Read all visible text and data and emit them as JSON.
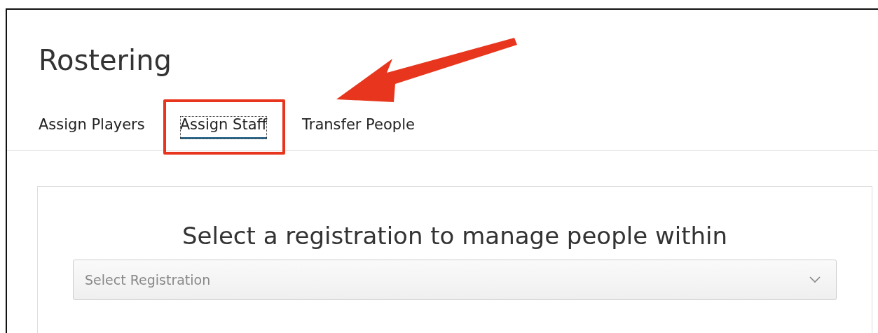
{
  "page": {
    "title": "Rostering"
  },
  "tabs": [
    {
      "label": "Assign Players",
      "selected": false,
      "highlighted": false
    },
    {
      "label": "Assign Staff",
      "selected": true,
      "highlighted": true
    },
    {
      "label": "Transfer People",
      "selected": false,
      "highlighted": false
    }
  ],
  "panel": {
    "heading": "Select a registration to manage people within",
    "select": {
      "placeholder": "Select Registration"
    }
  }
}
